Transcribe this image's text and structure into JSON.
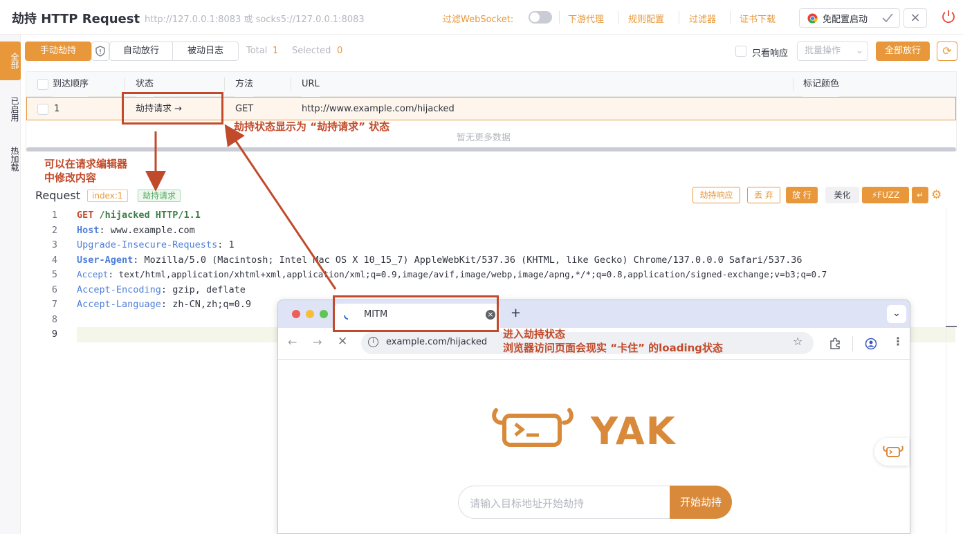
{
  "header": {
    "title": "劫持 HTTP Request",
    "address": "http://127.0.0.1:8083 或 socks5://127.0.0.1:8083",
    "ws_filter_label": "过滤WebSocket:",
    "links": [
      "下游代理",
      "规则配置",
      "过滤器",
      "证书下载"
    ],
    "chrome_button": "免配置启动"
  },
  "side_tabs": [
    "全部",
    "已启用",
    "热加载"
  ],
  "toolbar": {
    "manual_hijack": "手动劫持",
    "auto_release": "自动放行",
    "passive_log": "被动日志",
    "total_label": "Total",
    "total_value": "1",
    "selected_label": "Selected",
    "selected_value": "0",
    "only_response": "只看响应",
    "batch_ops": "批量操作",
    "release_all": "全部放行"
  },
  "table": {
    "columns": [
      "到达顺序",
      "状态",
      "方法",
      "URL",
      "标记颜色"
    ],
    "rows": [
      {
        "order": "1",
        "status": "劫持请求 →",
        "method": "GET",
        "url": "http://www.example.com/hijacked",
        "color": ""
      }
    ],
    "empty_more": "暂无更多数据"
  },
  "annotations": {
    "status_note": "劫持状态显示为 “劫持请求” 状态",
    "edit_note_1": "可以在请求编辑器",
    "edit_note_2": "中修改内容",
    "browser_note_1": "进入劫持状态",
    "browser_note_2": "浏览器访问页面会现实 “卡住” 的loading状态"
  },
  "editor": {
    "title": "Request",
    "index_tag": "index:1",
    "status_tag": "劫持请求",
    "buttons": [
      "劫持响应",
      "丢 弃",
      "放 行",
      "美化",
      "FUZZ"
    ],
    "lines": [
      {
        "num": "1",
        "key": "GET",
        "sep": " ",
        "value": "/hijacked HTTP/1.1"
      },
      {
        "num": "2",
        "key": "Host",
        "sep": ": ",
        "value": "www.example.com"
      },
      {
        "num": "3",
        "key": "Upgrade-Insecure-Requests",
        "sep": ": ",
        "value": "1"
      },
      {
        "num": "4",
        "key": "User-Agent",
        "sep": ": ",
        "value": "Mozilla/5.0 (Macintosh; Intel Mac OS X 10_15_7) AppleWebKit/537.36 (KHTML, like Gecko) Chrome/137.0.0.0 Safari/537.36"
      },
      {
        "num": "5",
        "key": "Accept",
        "sep": ": ",
        "value": "text/html,application/xhtml+xml,application/xml;q=0.9,image/avif,image/webp,image/apng,*/*;q=0.8,application/signed-exchange;v=b3;q=0.7"
      },
      {
        "num": "6",
        "key": "Accept-Encoding",
        "sep": ": ",
        "value": "gzip, deflate"
      },
      {
        "num": "7",
        "key": "Accept-Language",
        "sep": ": ",
        "value": "zh-CN,zh;q=0.9"
      },
      {
        "num": "8",
        "key": "",
        "sep": "",
        "value": ""
      },
      {
        "num": "9",
        "key": "",
        "sep": "",
        "value": ""
      }
    ]
  },
  "browser": {
    "tab_title": "MITM",
    "new_tab": "+",
    "url": "example.com/hijacked",
    "logo_text": "YAK",
    "search_placeholder": "请输入目标地址开始劫持",
    "start_button": "开始劫持"
  },
  "colors": {
    "accent": "#e8983b",
    "annotation": "#c14a2a",
    "key": "#4f7fd9"
  }
}
